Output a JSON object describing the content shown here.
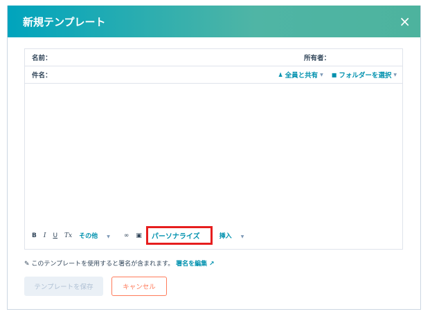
{
  "modal": {
    "title": "新規テンプレート",
    "close": "×"
  },
  "fields": {
    "name_label": "名前：",
    "owner_label": "所有者：",
    "subject_label": "件名：",
    "share_label": "全員と共有",
    "folder_label": "フォルダーを選択"
  },
  "toolbar": {
    "bold": "B",
    "italic": "I",
    "underline": "U",
    "clear_format": "Tx",
    "more": "その他",
    "personalize": "パーソナライズ",
    "insert": "挿入"
  },
  "signature": {
    "text": "このテンプレートを使用すると署名が含まれます。",
    "edit_link": "署名を編集"
  },
  "buttons": {
    "save": "テンプレートを保存",
    "cancel": "キャンセル"
  },
  "colors": {
    "header_gradient_start": "#00a4bd",
    "header_gradient_end": "#4db39e",
    "link": "#0091ae",
    "cancel": "#ff7a59",
    "highlight": "#e61e1e"
  }
}
